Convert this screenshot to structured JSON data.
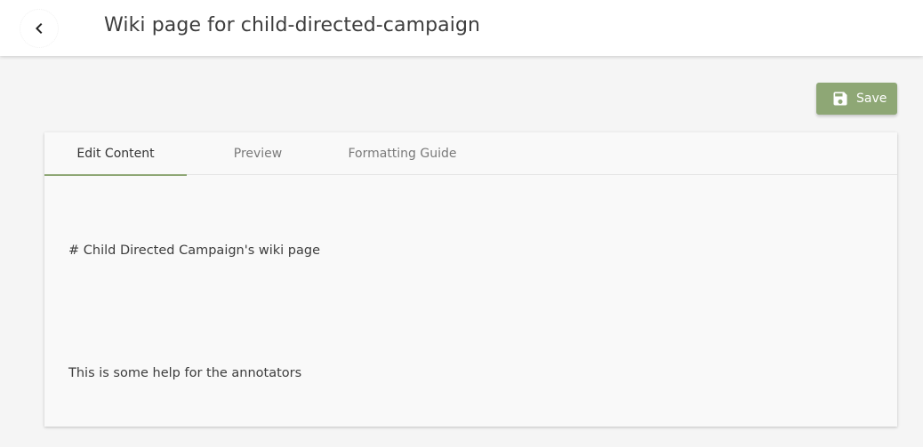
{
  "header": {
    "title": "Wiki page for child-directed-campaign",
    "back_icon": "chevron-left-icon"
  },
  "toolbar": {
    "save_label": "Save",
    "save_icon": "floppy-disk-icon"
  },
  "tabs": [
    {
      "label": "Edit Content",
      "active": true
    },
    {
      "label": "Preview",
      "active": false
    },
    {
      "label": "Formatting Guide",
      "active": false
    }
  ],
  "editor": {
    "lines": [
      "# Child Directed Campaign's wiki page",
      "",
      "This is some help for the annotators"
    ]
  },
  "colors": {
    "accent": "#8ea775",
    "background": "#f5f5f5",
    "card": "#f9f9f9"
  }
}
